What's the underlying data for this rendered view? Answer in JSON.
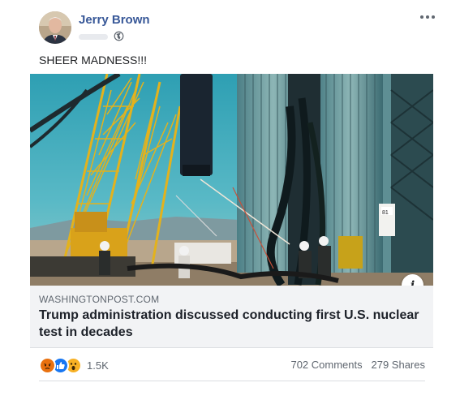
{
  "post": {
    "author": "Jerry Brown",
    "audience_icon": "globe-icon",
    "more_icon": "more-options-icon",
    "text": "SHEER MADNESS!!!"
  },
  "link": {
    "domain": "WASHINGTONPOST.COM",
    "headline": "Trump administration discussed conducting first U.S. nuclear test in decades",
    "image_label": "81",
    "info_icon": "i"
  },
  "engagement": {
    "reaction_icons": [
      "angry-reaction-icon",
      "like-reaction-icon",
      "wow-reaction-icon"
    ],
    "reaction_count": "1.5K",
    "comments": "702 Comments",
    "shares": "279 Shares"
  },
  "colors": {
    "author_link": "#385898",
    "secondary_text": "#606770",
    "link_meta_bg": "#f2f3f5",
    "like_blue": "#1877f2",
    "angry_orange": "#e9710f",
    "wow_yellow": "#f7b125"
  }
}
